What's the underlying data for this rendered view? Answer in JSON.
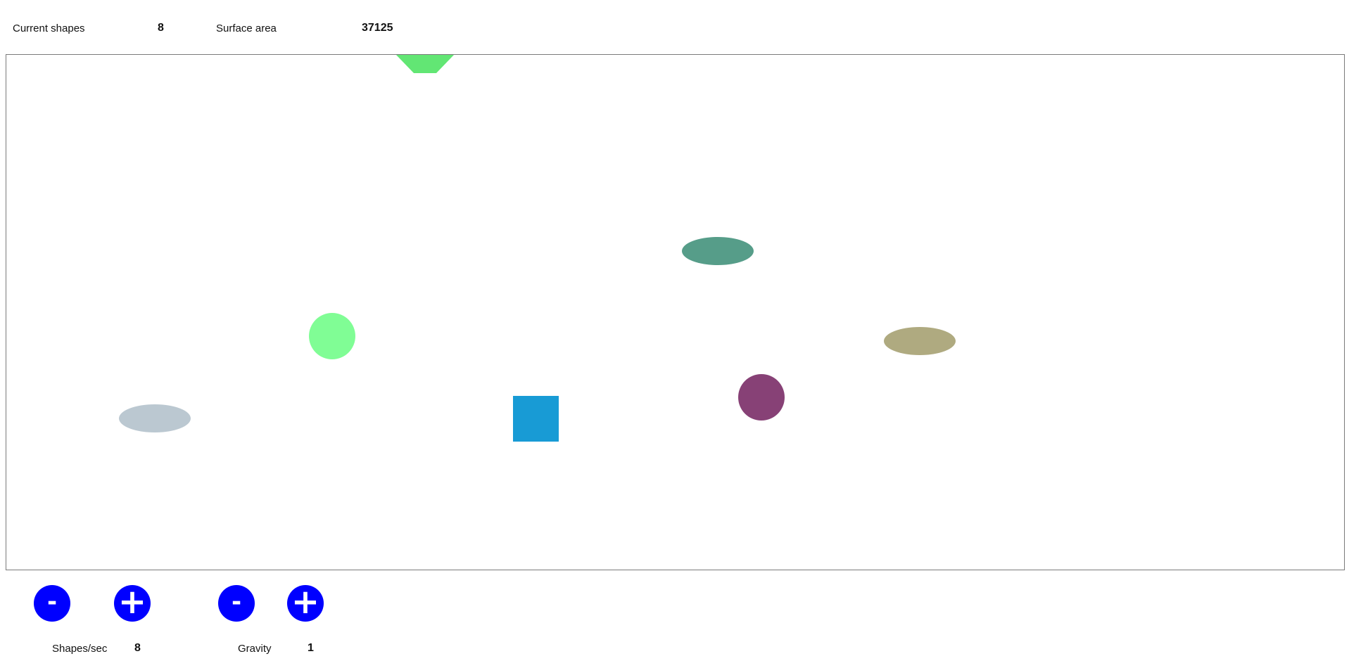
{
  "stats": {
    "current_shapes_label": "Current shapes",
    "current_shapes_value": "8",
    "surface_area_label": "Surface area",
    "surface_area_value": "37125"
  },
  "controls": {
    "shapes_per_sec": {
      "label": "Shapes/sec",
      "value": "8",
      "minus_label": "-",
      "plus_label": "+",
      "minus_icon": "minus-icon",
      "plus_icon": "plus-icon"
    },
    "gravity": {
      "label": "Gravity",
      "value": "1",
      "minus_label": "-",
      "plus_label": "+",
      "minus_icon": "minus-icon",
      "plus_icon": "plus-icon"
    },
    "button_color": "#0000ff"
  },
  "shapes": [
    {
      "kind": "hexagon",
      "color": "#62e674"
    },
    {
      "kind": "ellipse",
      "color": "#569d89"
    },
    {
      "kind": "circle",
      "color": "#80fd95"
    },
    {
      "kind": "ellipse",
      "color": "#afaa80"
    },
    {
      "kind": "circle",
      "color": "#874176"
    },
    {
      "kind": "square",
      "color": "#189bd5"
    },
    {
      "kind": "ellipse",
      "color": "#bbc8d1"
    }
  ]
}
